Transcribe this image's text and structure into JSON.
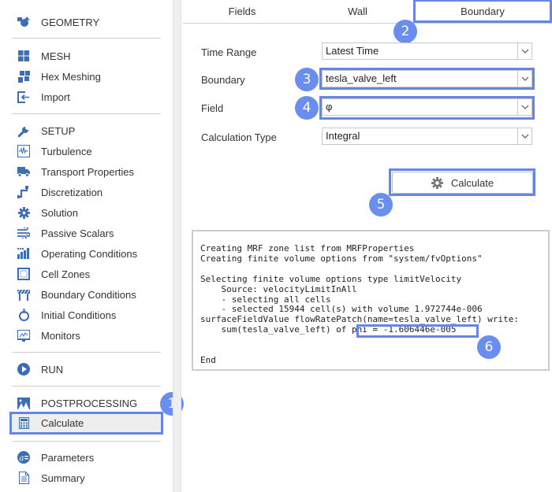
{
  "sidebar": {
    "sections": [
      {
        "items": [
          {
            "label": "GEOMETRY",
            "icon": "geometry-icon"
          }
        ]
      },
      {
        "items": [
          {
            "label": "MESH",
            "icon": "mesh-icon"
          },
          {
            "label": "Hex Meshing",
            "icon": "hex-meshing-icon"
          },
          {
            "label": "Import",
            "icon": "import-icon"
          }
        ]
      },
      {
        "items": [
          {
            "label": "SETUP",
            "icon": "wrench-icon"
          },
          {
            "label": "Turbulence",
            "icon": "turbulence-icon"
          },
          {
            "label": "Transport Properties",
            "icon": "truck-icon"
          },
          {
            "label": "Discretization",
            "icon": "discretization-icon"
          },
          {
            "label": "Solution",
            "icon": "gear-icon"
          },
          {
            "label": "Passive Scalars",
            "icon": "wind-icon"
          },
          {
            "label": "Operating Conditions",
            "icon": "bar-chart-icon"
          },
          {
            "label": "Cell Zones",
            "icon": "cell-zones-icon"
          },
          {
            "label": "Boundary Conditions",
            "icon": "barrier-icon"
          },
          {
            "label": "Initial Conditions",
            "icon": "stopwatch-icon"
          },
          {
            "label": "Monitors",
            "icon": "monitor-icon"
          }
        ]
      },
      {
        "items": [
          {
            "label": "RUN",
            "icon": "play-icon"
          }
        ]
      },
      {
        "items": [
          {
            "label": "POSTPROCESSING",
            "icon": "image-icon"
          },
          {
            "label": "Calculate",
            "icon": "calculator-icon",
            "selected": true
          }
        ]
      },
      {
        "items": [
          {
            "label": "Parameters",
            "icon": "parameters-icon"
          },
          {
            "label": "Summary",
            "icon": "document-icon"
          }
        ]
      }
    ]
  },
  "tabs": [
    {
      "label": "Fields",
      "active": false
    },
    {
      "label": "Wall",
      "active": false
    },
    {
      "label": "Boundary",
      "active": true
    }
  ],
  "form": {
    "time_range": {
      "label": "Time Range",
      "value": "Latest Time"
    },
    "boundary": {
      "label": "Boundary",
      "value": "tesla_valve_left"
    },
    "field": {
      "label": "Field",
      "value": "φ"
    },
    "calculation_type": {
      "label": "Calculation Type",
      "value": "Integral"
    }
  },
  "calculate_button": {
    "label": "Calculate",
    "icon": "gear-icon"
  },
  "console": {
    "lines": [
      "Creating MRF zone list from MRFProperties",
      "Creating finite volume options from \"system/fvOptions\"",
      "",
      "Selecting finite volume options type limitVelocity",
      "    Source: velocityLimitInAll",
      "    - selecting all cells",
      "    - selected 15944 cell(s) with volume 1.972744e-006",
      "surfaceFieldValue flowRatePatch(name=tesla_valve_left) write:",
      "    sum(tesla_valve_left) of phi = -1.606446e-005",
      "",
      "",
      "End"
    ],
    "result_highlight": "phi = -1.606446e-005"
  },
  "annotations": [
    "1",
    "2",
    "3",
    "4",
    "5",
    "6"
  ],
  "colors": {
    "accent": "#6585e8",
    "badge": "#6a8ef0",
    "icon": "#3d6db5"
  }
}
